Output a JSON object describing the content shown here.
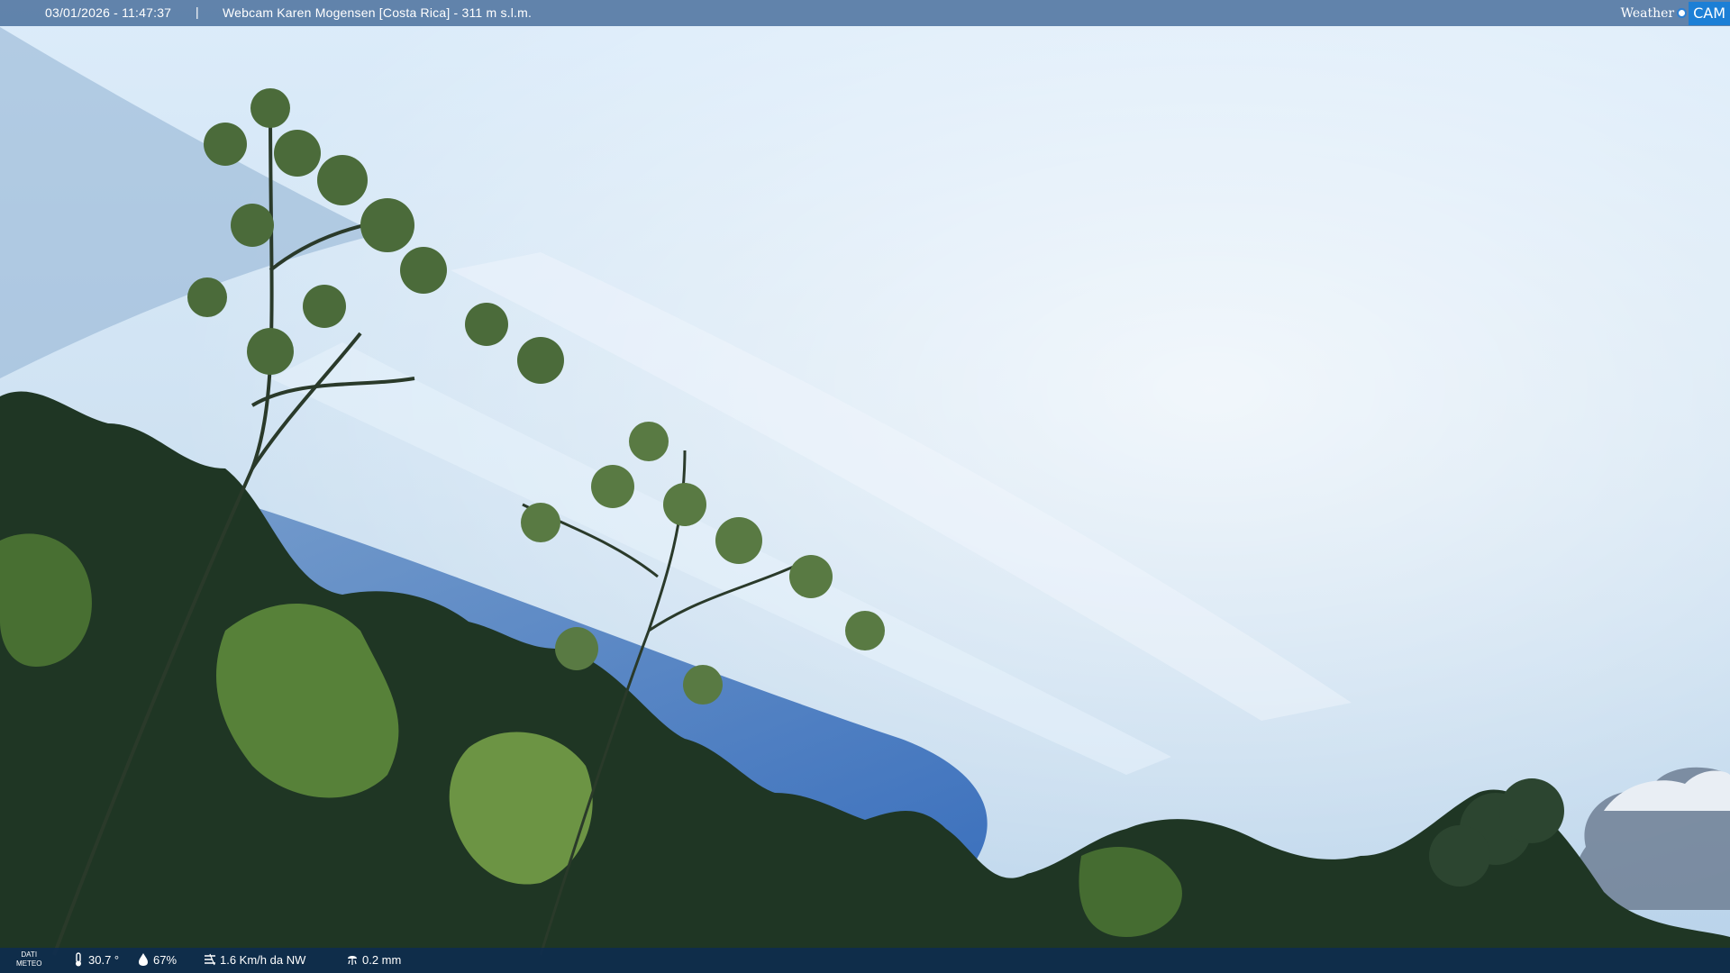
{
  "overlay": {
    "timestamp": "03/01/2026 - 11:47:37",
    "separator": "|",
    "camera_title": "Webcam Karen Mogensen [Costa Rica] - 311 m s.l.m.",
    "logo_weather": "Weather",
    "logo_cam": "CAM"
  },
  "meteo": {
    "label_line1": "DATI",
    "label_line2": "METEO",
    "temperature": "30.7 °",
    "humidity": "67%",
    "wind": "1.6 Km/h da NW",
    "rain": "0.2 mm"
  },
  "icons": [
    "thermometer-icon",
    "humidity-icon",
    "wind-icon",
    "rain-icon"
  ],
  "colors": {
    "sky_top": "#dfeefa",
    "sky_blue": "#3e76c2",
    "foliage_dark": "#1f3624",
    "foliage_light": "#6f9a48",
    "bar_top": "#5679a4",
    "bar_bottom": "#0e2c50",
    "logo_accent": "#1c7fd6"
  }
}
